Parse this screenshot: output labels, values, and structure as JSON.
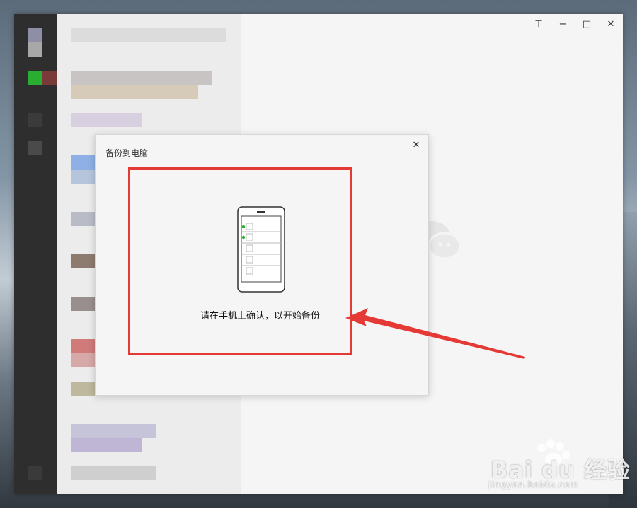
{
  "window_controls": {
    "pin": "⊤",
    "minimize": "−",
    "maximize": "□",
    "close": "✕"
  },
  "dialog": {
    "title": "备份到电脑",
    "close": "✕",
    "message": "请在手机上确认，以开始备份"
  },
  "watermark": {
    "brand": "Bai du 经验",
    "url": "jingyan.baidu.com"
  },
  "colors": {
    "highlight": "#e53935",
    "accent_green": "#2aae31",
    "sidebar_dark": "#2e2e2e"
  },
  "icons": [
    "pin-icon",
    "minimize-icon",
    "maximize-icon",
    "close-icon",
    "phone-icon",
    "wechat-logo-icon",
    "arrow-icon"
  ]
}
